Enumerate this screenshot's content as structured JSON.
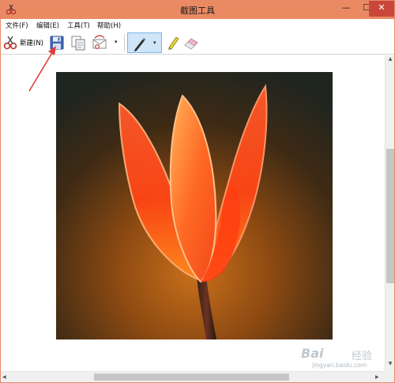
{
  "window": {
    "title": "截图工具",
    "min_glyph": "—",
    "max_glyph": "☐",
    "close_glyph": "✕"
  },
  "menu": {
    "items": [
      "文件(F)",
      "编辑(E)",
      "工具(T)",
      "帮助(H)"
    ]
  },
  "toolbar": {
    "new_label": "新建(N)",
    "dropdown_glyph": "▾"
  },
  "scroll": {
    "up_glyph": "▲",
    "down_glyph": "▼",
    "left_glyph": "◀",
    "right_glyph": "▶"
  },
  "watermark": {
    "brand": "Bai",
    "brand_cn": "经验",
    "url": "jingyan.baidu.com"
  },
  "colors": {
    "titlebar": "#ea8a63",
    "close_button": "#c9473a",
    "annotation_arrow": "#e23b3b",
    "pen_selected_bg": "#cfe5f8"
  },
  "icons": {
    "app": "scissors-app-icon",
    "new": "scissors-new-icon",
    "save": "floppy-save-icon",
    "copy": "copy-icon",
    "send": "send-email-icon",
    "pen": "pen-icon",
    "highlighter": "highlighter-icon",
    "eraser": "eraser-icon"
  }
}
